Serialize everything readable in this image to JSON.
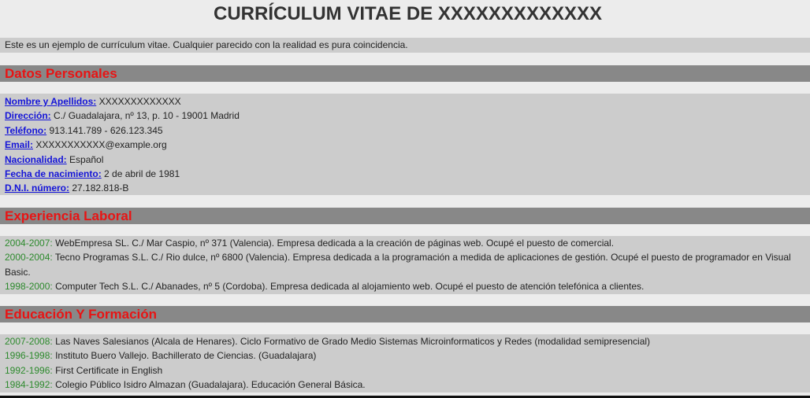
{
  "page_title": "CURRÍCULUM VITAE DE XXXXXXXXXXXXX",
  "intro": "Este es un ejemplo de currículum vitae. Cualquier parecido con la realidad es pura coincidencia.",
  "personal": {
    "heading": "Datos Personales",
    "fields": [
      {
        "label": "Nombre y Apellidos:",
        "value": "XXXXXXXXXXXXX"
      },
      {
        "label": "Dirección:",
        "value": "C./ Guadalajara, nº 13, p. 10 - 19001 Madrid"
      },
      {
        "label": "Teléfono:",
        "value": "913.141.789 - 626.123.345"
      },
      {
        "label": "Email:",
        "value": "XXXXXXXXXXX@example.org"
      },
      {
        "label": "Nacionalidad:",
        "value": "Español"
      },
      {
        "label": "Fecha de nacimiento:",
        "value": "2 de abril de 1981"
      },
      {
        "label": "D.N.I. número:",
        "value": "27.182.818-B"
      }
    ]
  },
  "experience": {
    "heading": "Experiencia Laboral",
    "items": [
      {
        "years": "2004-2007:",
        "text": "WebEmpresa SL. C./ Mar Caspio, nº 371 (Valencia). Empresa dedicada a la creación de páginas web. Ocupé el puesto de comercial."
      },
      {
        "years": "2000-2004:",
        "text": "Tecno Programas S.L. C./ Rio dulce, nº 6800 (Valencia). Empresa dedicada a la programación a medida de aplicaciones de gestión. Ocupé el puesto de programador en Visual Basic."
      },
      {
        "years": "1998-2000:",
        "text": "Computer Tech S.L. C./ Abanades, nº 5 (Cordoba). Empresa dedicada al alojamiento web. Ocupé el puesto de atención telefónica a clientes."
      }
    ]
  },
  "education": {
    "heading": "Educación Y Formación",
    "items": [
      {
        "years": "2007-2008:",
        "text": "Las Naves Salesianos (Alcala de Henares). Ciclo Formativo de Grado Medio Sistemas Microinformaticos y Redes (modalidad semipresencial)"
      },
      {
        "years": "1996-1998:",
        "text": "Instituto Buero Vallejo. Bachillerato de Ciencias. (Guadalajara)"
      },
      {
        "years": "1992-1996:",
        "text": "First Certificate in English"
      },
      {
        "years": "1984-1992:",
        "text": "Colegio Público Isidro Almazan (Guadalajara). Educación General Básica."
      }
    ]
  }
}
